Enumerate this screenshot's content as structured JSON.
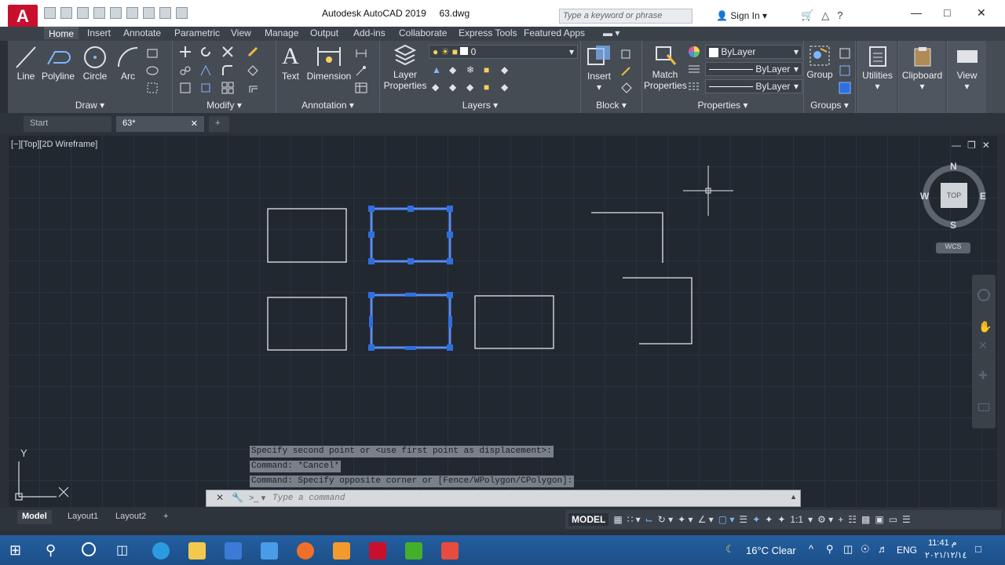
{
  "app": {
    "logo": "A",
    "title": "Autodesk AutoCAD 2019",
    "filename": "63.dwg",
    "search_placeholder": "Type a keyword or phrase",
    "sign_in": "Sign In"
  },
  "ribbon_tabs": [
    "Home",
    "Insert",
    "Annotate",
    "Parametric",
    "View",
    "Manage",
    "Output",
    "Add-ins",
    "Collaborate",
    "Express Tools",
    "Featured Apps"
  ],
  "ribbon": {
    "draw": {
      "title": "Draw",
      "tools": [
        "Line",
        "Polyline",
        "Circle",
        "Arc"
      ]
    },
    "modify": {
      "title": "Modify"
    },
    "annotation": {
      "title": "Annotation",
      "tools": [
        "Text",
        "Dimension"
      ]
    },
    "layers": {
      "title": "Layers",
      "tool_line1": "Layer",
      "tool_line2": "Properties",
      "current_layer": "0"
    },
    "block": {
      "title": "Block",
      "tool": "Insert"
    },
    "properties": {
      "title": "Properties",
      "tool_line1": "Match",
      "tool_line2": "Properties",
      "color": "ByLayer",
      "linetype": "ByLayer",
      "lineweight": "ByLayer"
    },
    "groups": {
      "title": "Groups",
      "tool": "Group"
    },
    "utilities": "Utilities",
    "clipboard": "Clipboard",
    "view": "View"
  },
  "file_tabs": [
    "Start",
    "63*"
  ],
  "viewport": {
    "label": "[−][Top][2D Wireframe]",
    "compass": {
      "n": "N",
      "s": "S",
      "e": "E",
      "w": "W",
      "center": "TOP",
      "wcs": "WCS"
    },
    "ucs": {
      "y": "Y"
    }
  },
  "command": {
    "history": [
      "Specify second point or <use first point as displacement>:",
      "Command: *Cancel*",
      "Command: Specify opposite corner or [Fence/WPolygon/CPolygon]:"
    ],
    "placeholder": "Type a command"
  },
  "layout_tabs": [
    "Model",
    "Layout1",
    "Layout2"
  ],
  "status": {
    "model": "MODEL",
    "scale": "1:1"
  },
  "taskbar": {
    "weather": "16°C  Clear",
    "lang": "ENG",
    "time": "11:41 م",
    "date": "٢٠٢١/١٢/١٤"
  },
  "colors": {
    "selection": "#2f6fe0",
    "canvas": "#212830",
    "accent": "#c8102e"
  }
}
